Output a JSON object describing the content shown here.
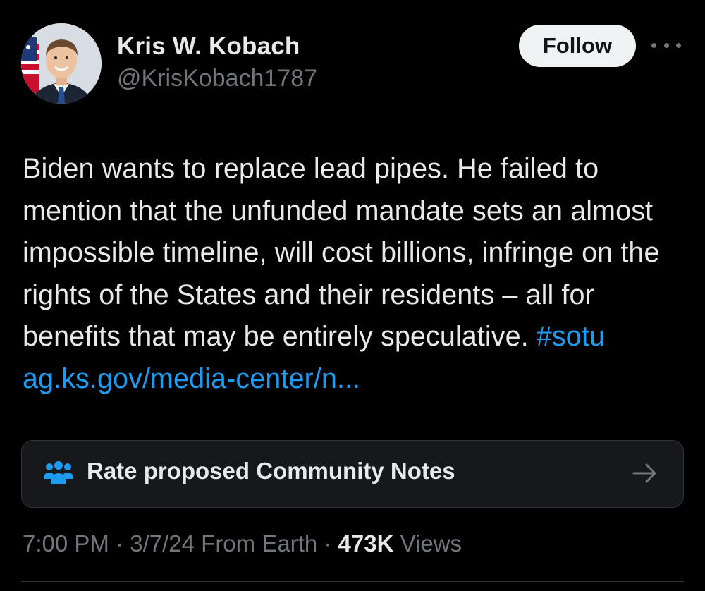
{
  "author": {
    "name": "Kris W. Kobach",
    "handle": "@KrisKobach1787"
  },
  "actions": {
    "follow_label": "Follow"
  },
  "tweet": {
    "text": "Biden wants to replace lead pipes. He failed to mention that the unfunded mandate sets an almost impossible timeline, will cost billions, infringe on the rights of the States and their residents – all for benefits that may be entirely speculative. ",
    "hashtag": "#sotu",
    "link": "ag.ks.gov/media-center/n..."
  },
  "community_notes": {
    "label": "Rate proposed Community Notes",
    "icon": "people-icon"
  },
  "meta": {
    "time": "7:00 PM",
    "date": "3/7/24",
    "source": "From Earth",
    "views_count": "473K",
    "views_label": "Views",
    "separator": " · "
  },
  "colors": {
    "background": "#000000",
    "text": "#e7e9ea",
    "muted": "#71767b",
    "link": "#1d9bf0",
    "follow_bg": "#eff3f4"
  }
}
